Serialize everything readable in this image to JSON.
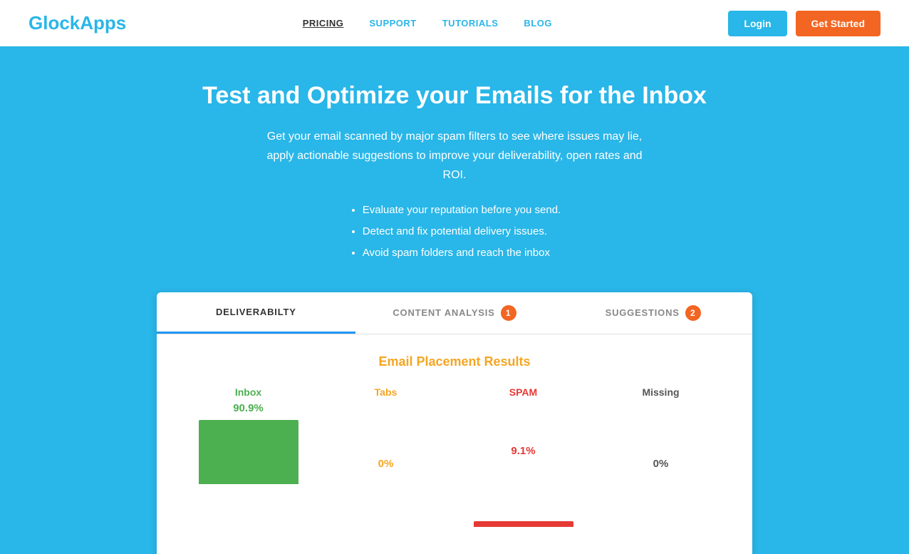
{
  "header": {
    "logo_black": "Glock",
    "logo_blue": "Apps",
    "nav": [
      {
        "label": "PRICING",
        "active": true,
        "blue": false
      },
      {
        "label": "SUPPORT",
        "active": false,
        "blue": true
      },
      {
        "label": "TUTORIALS",
        "active": false,
        "blue": true
      },
      {
        "label": "BLOG",
        "active": false,
        "blue": true
      }
    ],
    "login_label": "Login",
    "get_started_label": "Get Started"
  },
  "hero": {
    "title": "Test and Optimize your Emails for the Inbox",
    "description": "Get your email scanned by major spam filters to see where issues may lie, apply actionable suggestions to improve your deliverability, open rates and ROI.",
    "bullets": [
      "Evaluate your reputation before you send.",
      "Detect and fix potential delivery issues.",
      "Avoid spam folders and reach the inbox"
    ]
  },
  "tabs": [
    {
      "label": "DELIVERABILTY",
      "badge": null,
      "active": true
    },
    {
      "label": "CONTENT ANALYSIS",
      "badge": "1",
      "active": false
    },
    {
      "label": "SUGGESTIONS",
      "badge": "2",
      "active": false
    }
  ],
  "results": {
    "section_title_plain": "Email ",
    "section_title_highlight": "Placement",
    "section_title_rest": " Results",
    "columns": [
      {
        "label": "Inbox",
        "color": "green",
        "pct": "90.9%",
        "bar_type": "green"
      },
      {
        "label": "Tabs",
        "color": "orange",
        "pct": "0%",
        "bar_type": "orange"
      },
      {
        "label": "SPAM",
        "color": "red",
        "pct": "9.1%",
        "bar_type": "red"
      },
      {
        "label": "Missing",
        "color": "dark",
        "pct": "0%",
        "bar_type": "gray"
      }
    ]
  }
}
